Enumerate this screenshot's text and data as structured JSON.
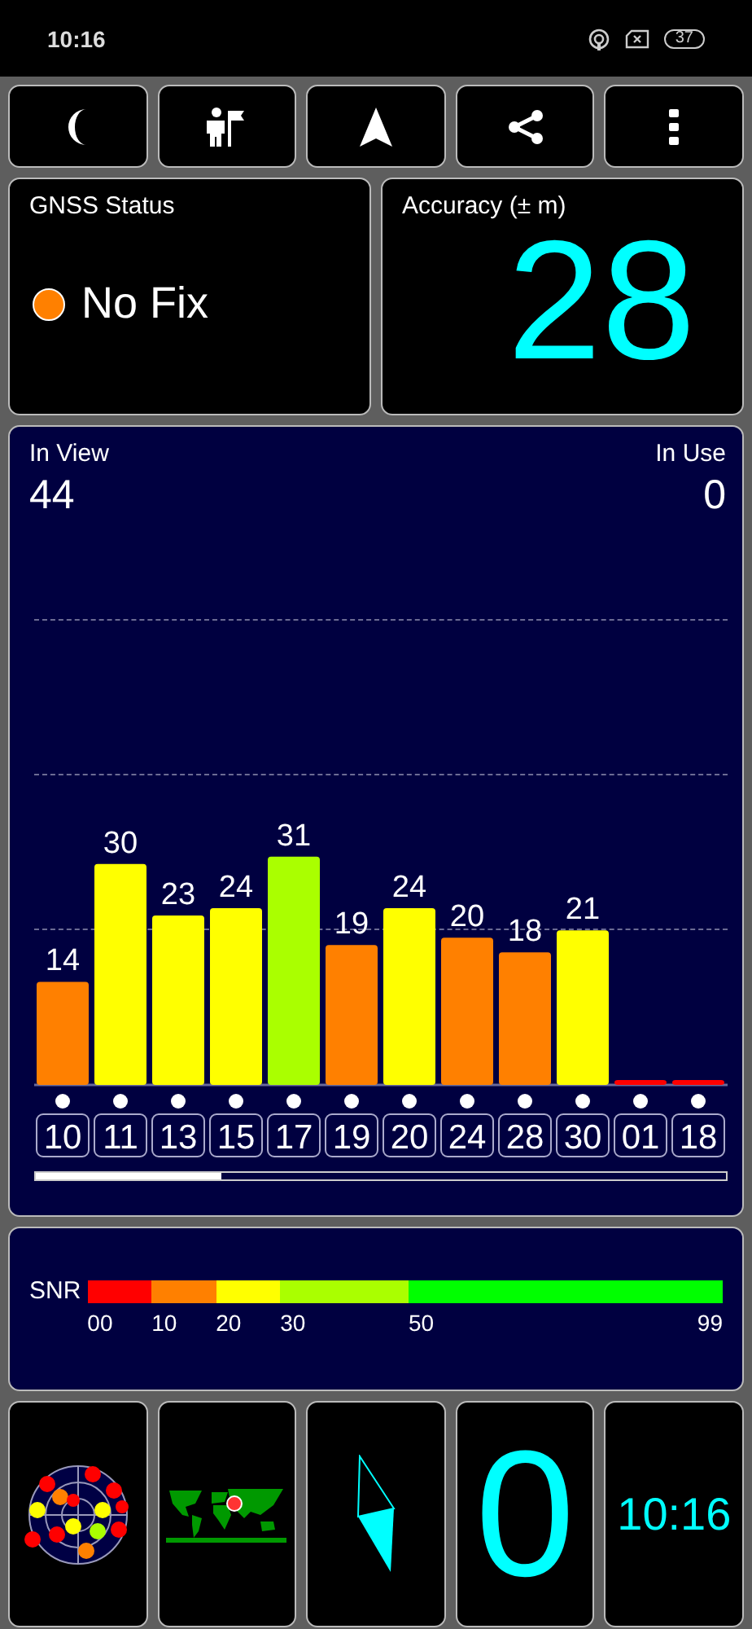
{
  "status_bar": {
    "time": "10:16",
    "battery": "37"
  },
  "toolbar": {
    "buttons": [
      {
        "kind": "moon"
      },
      {
        "kind": "person-flag"
      },
      {
        "kind": "navigation"
      },
      {
        "kind": "share"
      },
      {
        "kind": "more"
      }
    ]
  },
  "gnss_status": {
    "title": "GNSS Status",
    "color": "#ff8000",
    "text": "No Fix"
  },
  "accuracy": {
    "title": "Accuracy (± m)",
    "value": "28"
  },
  "satellites": {
    "in_view_label": "In View",
    "in_view": "44",
    "in_use_label": "In Use",
    "in_use": "0",
    "chart_data": {
      "type": "bar",
      "categories": [
        "10",
        "11",
        "13",
        "15",
        "17",
        "19",
        "20",
        "24",
        "28",
        "30",
        "01",
        "18"
      ],
      "series": [
        {
          "values": [
            14,
            30,
            23,
            24,
            31,
            19,
            24,
            20,
            18,
            21,
            null,
            null
          ]
        }
      ],
      "data_labels": true
    }
  },
  "snr_legend": {
    "label": "SNR",
    "segments": [
      {
        "start": "00",
        "color": "#ff0000"
      },
      {
        "start": "10",
        "color": "#ff8000"
      },
      {
        "start": "20",
        "color": "#ffff00"
      },
      {
        "start": "30",
        "color": "#aaff00"
      },
      {
        "start": "50",
        "color": "#00ff00"
      }
    ],
    "end": "99"
  },
  "tiles": [
    {
      "kind": "skyplot"
    },
    {
      "kind": "map"
    },
    {
      "kind": "compass"
    },
    {
      "kind": "text",
      "text": "0"
    },
    {
      "kind": "text",
      "text": "10:16"
    }
  ]
}
